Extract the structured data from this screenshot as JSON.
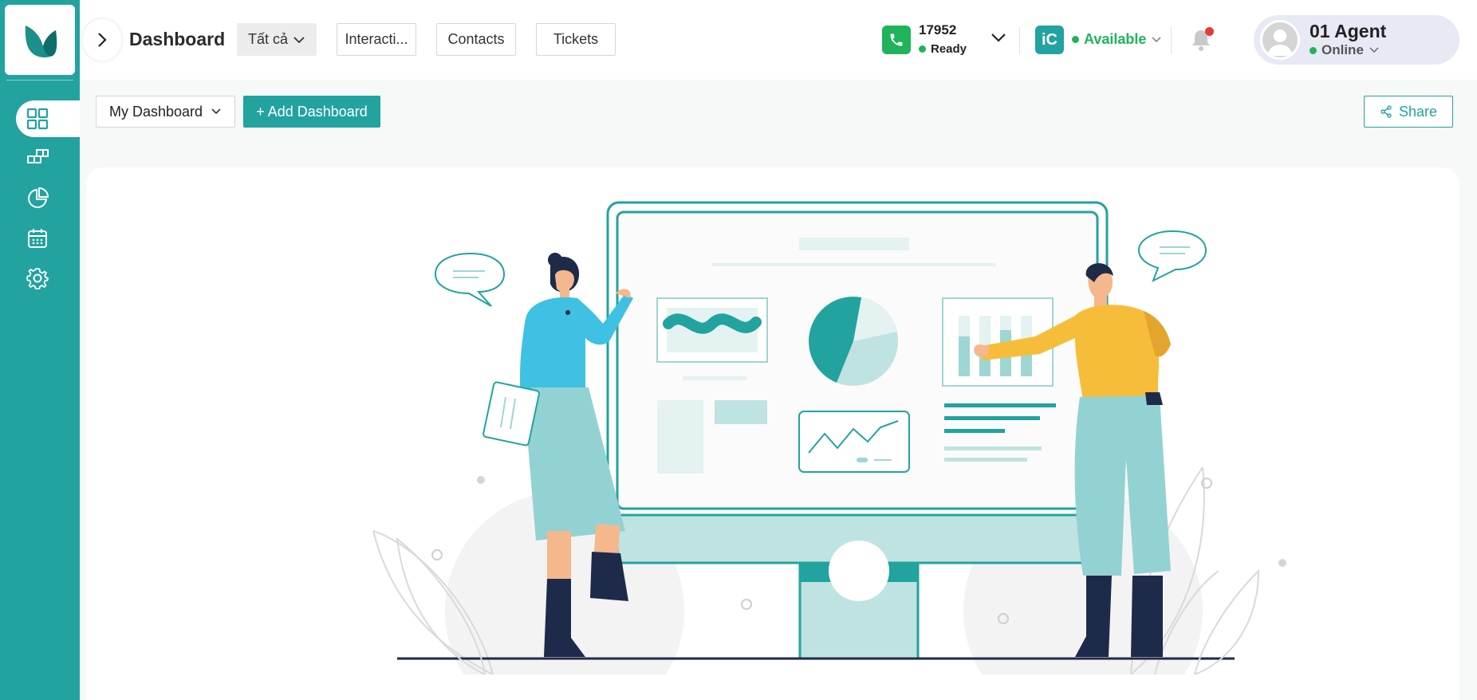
{
  "header": {
    "title": "Dashboard",
    "filter_label": "Tất cả",
    "tabs": [
      {
        "label": "Interacti..."
      },
      {
        "label": "Contacts"
      },
      {
        "label": "Tickets"
      }
    ]
  },
  "phone": {
    "extension": "17952",
    "status": "Ready"
  },
  "presence": {
    "status": "Available"
  },
  "agent": {
    "name": "01 Agent",
    "status": "Online"
  },
  "toolbar": {
    "dashboard_select": "My Dashboard",
    "add_dashboard": "+ Add Dashboard",
    "share": "Share"
  },
  "sidebar": {
    "items": [
      {
        "icon": "grid-icon",
        "active": true
      },
      {
        "icon": "blocks-icon",
        "active": false
      },
      {
        "icon": "pie-chart-icon",
        "active": false
      },
      {
        "icon": "calendar-icon",
        "active": false
      },
      {
        "icon": "gear-icon",
        "active": false
      }
    ]
  },
  "colors": {
    "brand": "#22a39f",
    "ready_green": "#1fb35a",
    "notification_red": "#e53935",
    "agent_pill": "#e7e9f5"
  }
}
